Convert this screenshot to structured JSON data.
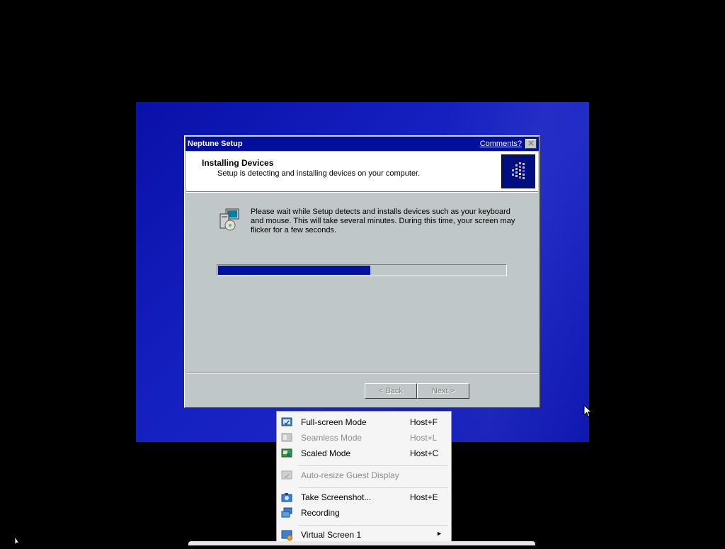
{
  "dialog": {
    "title": "Neptune Setup",
    "comments_link": "Comments?",
    "close_glyph": "✕",
    "header_title": "Installing Devices",
    "header_subtitle": "Setup is detecting and installing devices on your computer.",
    "body_text": "Please wait while Setup detects and installs devices such as your keyboard and mouse.  This will take several minutes.  During this time, your screen may flicker for a few seconds.",
    "progress_fraction": 0.53,
    "back_button": "< Back",
    "next_button": "Next >",
    "titlebar_color": "#000f9c",
    "progress_color": "#0010a0"
  },
  "menu": {
    "items": [
      {
        "label": "Full-screen Mode",
        "shortcut": "Host+F",
        "icon": "fullscreen-icon",
        "enabled": true
      },
      {
        "label": "Seamless Mode",
        "shortcut": "Host+L",
        "icon": "seamless-icon",
        "enabled": false
      },
      {
        "label": "Scaled Mode",
        "shortcut": "Host+C",
        "icon": "scaled-icon",
        "enabled": true
      },
      {
        "label": "Auto-resize Guest Display",
        "shortcut": "",
        "icon": "auto-resize-icon",
        "enabled": false
      },
      {
        "label": "Take Screenshot...",
        "shortcut": "Host+E",
        "icon": "screenshot-icon",
        "enabled": true
      },
      {
        "label": "Recording",
        "shortcut": "",
        "icon": "recording-icon",
        "enabled": true
      },
      {
        "label": "Virtual Screen 1",
        "shortcut": "",
        "icon": "virtual-screen-icon",
        "enabled": true,
        "submenu_arrow": "►"
      }
    ]
  }
}
